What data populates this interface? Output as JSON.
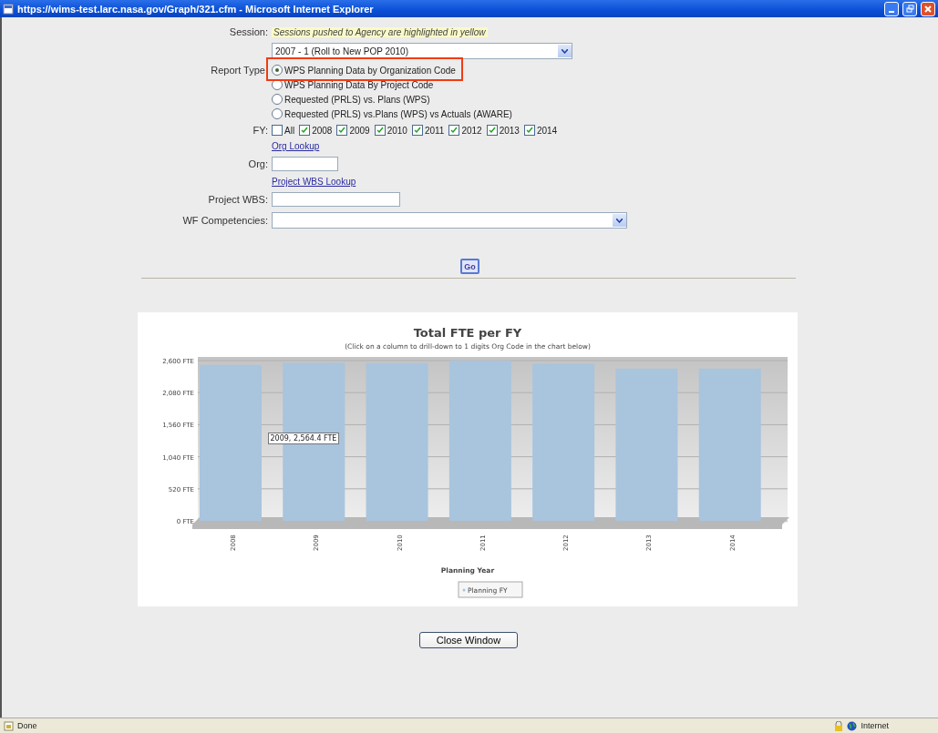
{
  "window": {
    "title": "https://wims-test.larc.nasa.gov/Graph/321.cfm - Microsoft Internet Explorer"
  },
  "form": {
    "session": {
      "label": "Session:",
      "hint": "Sessions pushed to Agency are highlighted in yellow",
      "value": "2007 - 1 (Roll to New POP 2010)",
      "highlighted": true
    },
    "report_type": {
      "label": "Report Type:",
      "options": [
        {
          "label": "WPS Planning Data by Organization Code",
          "selected": true
        },
        {
          "label": "WPS Planning Data By Project Code",
          "selected": false
        },
        {
          "label": "Requested (PRLS) vs. Plans (WPS)",
          "selected": false
        },
        {
          "label": "Requested (PRLS) vs.Plans (WPS) vs Actuals (AWARE)",
          "selected": false
        }
      ]
    },
    "fy": {
      "label": "FY:",
      "options": [
        {
          "label": "All",
          "checked": false
        },
        {
          "label": "2008",
          "checked": true
        },
        {
          "label": "2009",
          "checked": true
        },
        {
          "label": "2010",
          "checked": true
        },
        {
          "label": "2011",
          "checked": true
        },
        {
          "label": "2012",
          "checked": true
        },
        {
          "label": "2013",
          "checked": true
        },
        {
          "label": "2014",
          "checked": true
        }
      ]
    },
    "org_lookup": "Org Lookup",
    "org": {
      "label": "Org:"
    },
    "project_wbs_lookup": "Project WBS Lookup",
    "project_wbs": {
      "label": "Project WBS:"
    },
    "wf_competencies": {
      "label": "WF Competencies:"
    },
    "go_button": "Go"
  },
  "chart": {
    "subtitle": "(Click on a column to drill-down to 1 digits Org Code in the chart below)",
    "tooltip": "2009, 2,564.4 FTE",
    "chart_data": {
      "type": "bar",
      "title": "Total FTE per FY",
      "xlabel": "Planning Year",
      "categories": [
        "2008",
        "2009",
        "2010",
        "2011",
        "2012",
        "2013",
        "2014"
      ],
      "series": [
        {
          "name": "Planning FY",
          "color": "#a9c4dd",
          "values": [
            2530,
            2564.4,
            2560,
            2600,
            2550,
            2470,
            2470
          ]
        }
      ],
      "ylim": [
        0,
        2600
      ],
      "grid": true,
      "yticks": [
        {
          "value": 0,
          "label": "0 FTE"
        },
        {
          "value": 520,
          "label": "520 FTE"
        },
        {
          "value": 1040,
          "label": "1,040 FTE"
        },
        {
          "value": 1560,
          "label": "1,560 FTE"
        },
        {
          "value": 2080,
          "label": "2,080 FTE"
        },
        {
          "value": 2600,
          "label": "2,600 FTE"
        }
      ]
    }
  },
  "close_button": "Close Window",
  "status_bar": {
    "status": "Done",
    "zone": "Internet"
  }
}
